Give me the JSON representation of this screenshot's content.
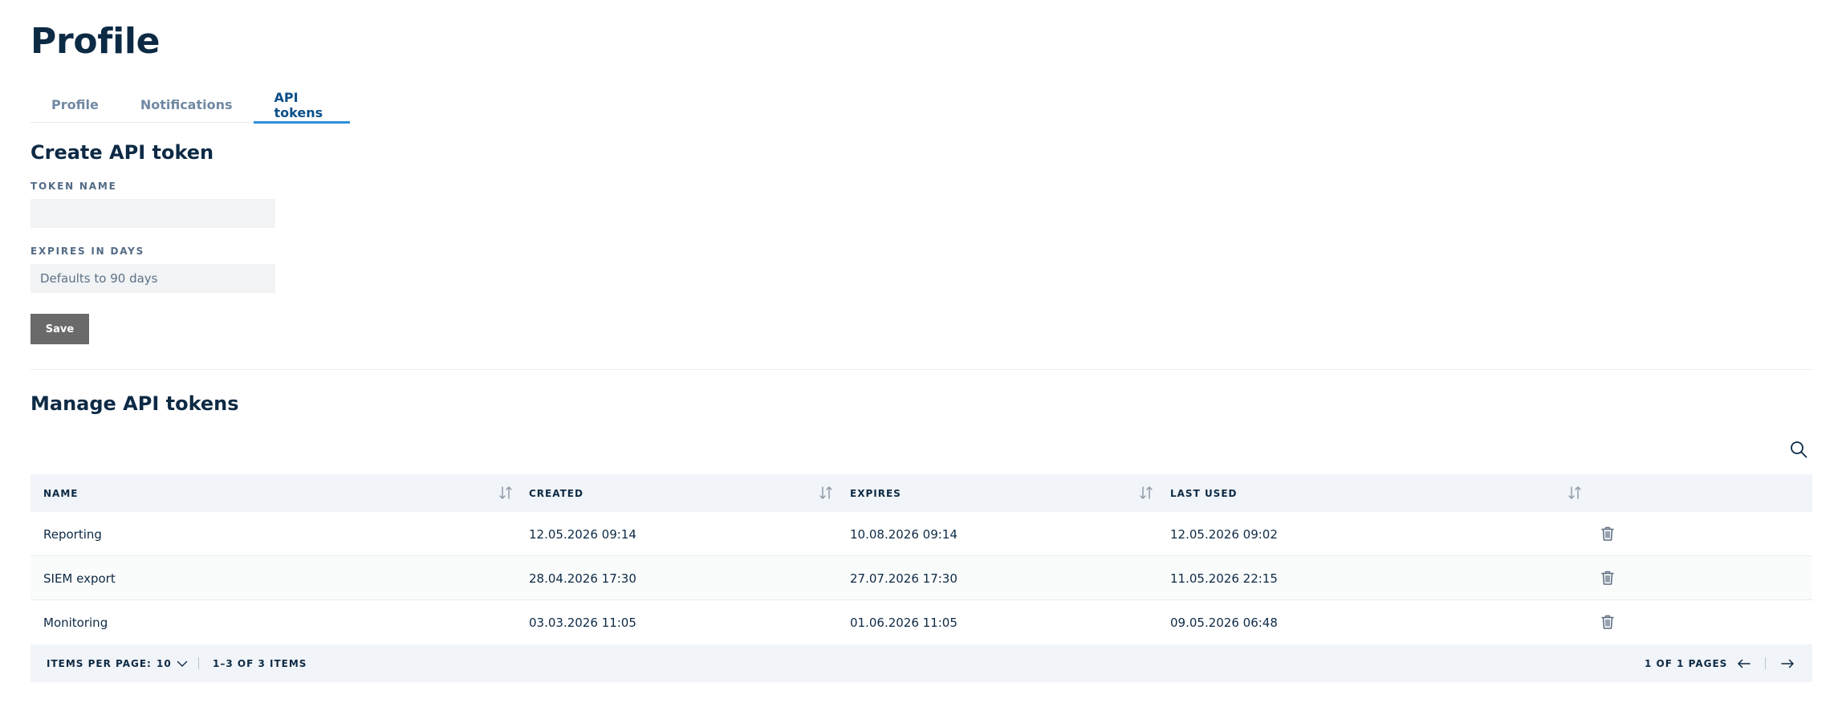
{
  "page": {
    "title": "Profile"
  },
  "tabs": [
    {
      "label": "Profile",
      "active": false
    },
    {
      "label": "Notifications",
      "active": false
    },
    {
      "label": "API tokens",
      "active": true
    }
  ],
  "create_section": {
    "title": "Create API token",
    "token_name": {
      "label": "TOKEN NAME",
      "value": "",
      "placeholder": ""
    },
    "expires": {
      "label": "EXPIRES IN DAYS",
      "value": "",
      "placeholder": "Defaults to 90 days"
    },
    "save_label": "Save"
  },
  "manage_section": {
    "title": "Manage API tokens",
    "columns": [
      "NAME",
      "CREATED",
      "EXPIRES",
      "LAST USED"
    ],
    "rows": [
      {
        "name": "Reporting",
        "created": "12.05.2026 09:14",
        "expires": "10.08.2026 09:14",
        "last_used": "12.05.2026 09:02"
      },
      {
        "name": "SIEM export",
        "created": "28.04.2026 17:30",
        "expires": "27.07.2026 17:30",
        "last_used": "11.05.2026 22:15"
      },
      {
        "name": "Monitoring",
        "created": "03.03.2026 11:05",
        "expires": "01.06.2026 11:05",
        "last_used": "09.05.2026 06:48"
      }
    ]
  },
  "pagination": {
    "items_per_page_label": "ITEMS PER PAGE:",
    "items_per_page": "10",
    "range": "1–3 OF 3 ITEMS",
    "pages": "1 OF 1 PAGES"
  },
  "icons": [
    "sort-icon",
    "search-icon",
    "trash-icon",
    "chevron-down-icon",
    "arrow-left-icon",
    "arrow-right-icon"
  ],
  "colors": {
    "accent": "#2f90d8",
    "heading": "#0d2a45",
    "button": "#6a6a6a",
    "header_bg": "#f1f4f8"
  }
}
